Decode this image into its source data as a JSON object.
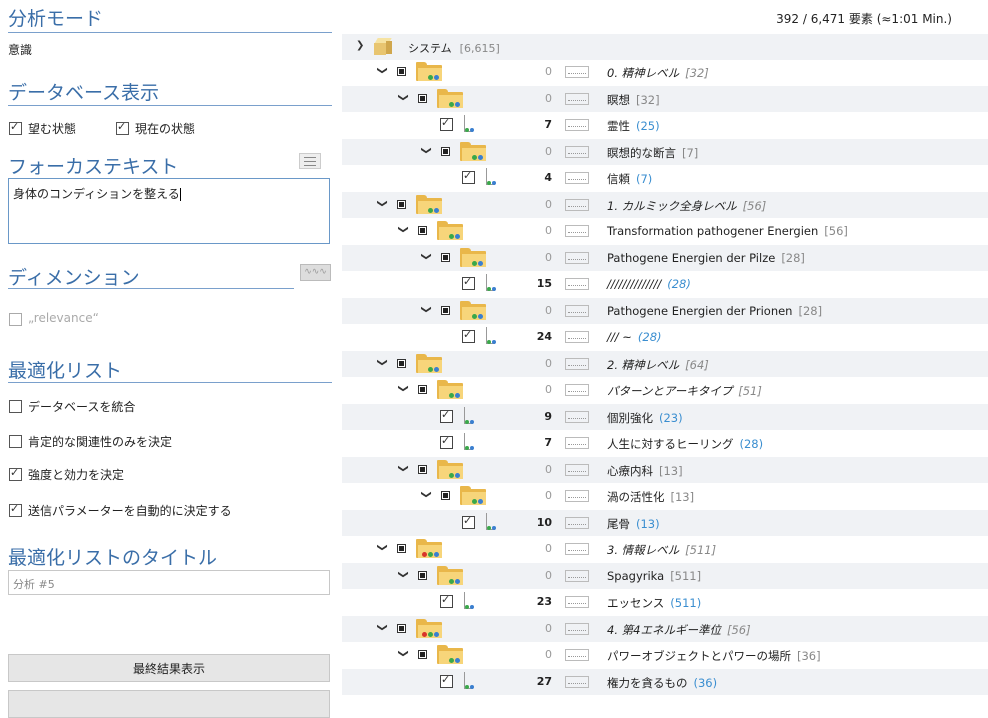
{
  "left": {
    "analysis_mode": {
      "title": "分析モード",
      "value": "意識"
    },
    "database_display": {
      "title": "データベース表示",
      "desired_label": "望む状態",
      "current_label": "現在の状態"
    },
    "focus_text": {
      "title": "フォーカステキスト",
      "value": "身体のコンディションを整える"
    },
    "dimension": {
      "title": "ディメンション",
      "relevance_label": "„relevance“"
    },
    "optimization_list": {
      "title": "最適化リスト",
      "options": [
        {
          "label": "データベースを統合",
          "checked": false
        },
        {
          "label": "肯定的な関連性のみを決定",
          "checked": false
        },
        {
          "label": "強度と効力を決定",
          "checked": true
        },
        {
          "label": "送信パラメーターを自動的に決定する",
          "checked": true
        }
      ]
    },
    "list_title": {
      "title": "最適化リストのタイトル",
      "placeholder": "分析 #5"
    },
    "buttons": {
      "show_final": "最終結果表示"
    }
  },
  "right": {
    "count": "392 / 6,471 要素 (≈1:01 Min.)",
    "root": {
      "label": "システム",
      "bracket": "[6,615]"
    },
    "rows": [
      {
        "level": 1,
        "kind": "folder",
        "num": "0",
        "label": "0. 精神レベル",
        "bracket": "[32]",
        "italic": true,
        "alt": false
      },
      {
        "level": 2,
        "kind": "folder",
        "num": "0",
        "label": "瞑想",
        "bracket": "[32]",
        "alt": true
      },
      {
        "level": 3,
        "kind": "leaf",
        "num": "7",
        "label": "霊性",
        "link": "(25)",
        "alt": false
      },
      {
        "level": 3,
        "kind": "folder",
        "num": "0",
        "label": "瞑想的な断言",
        "bracket": "[7]",
        "alt": true
      },
      {
        "level": 4,
        "kind": "leaf",
        "num": "4",
        "label": "信頼",
        "link": "(7)",
        "alt": false
      },
      {
        "level": 1,
        "kind": "folder",
        "num": "0",
        "label": "1. カルミック全身レベル",
        "bracket": "[56]",
        "italic": true,
        "alt": true
      },
      {
        "level": 2,
        "kind": "folder",
        "num": "0",
        "label": "Transformation pathogener Energien",
        "bracket": "[56]",
        "alt": false
      },
      {
        "level": 3,
        "kind": "folder",
        "num": "0",
        "label": "Pathogene Energien der Pilze",
        "bracket": "[28]",
        "alt": true
      },
      {
        "level": 4,
        "kind": "leaf",
        "num": "15",
        "label": "//////////////",
        "link": "(28)",
        "italic": true,
        "alt": false
      },
      {
        "level": 3,
        "kind": "folder",
        "num": "0",
        "label": "Pathogene Energien der Prionen",
        "bracket": "[28]",
        "alt": true
      },
      {
        "level": 4,
        "kind": "leaf",
        "num": "24",
        "label": "/// ~",
        "link": "(28)",
        "italic": true,
        "alt": false
      },
      {
        "level": 1,
        "kind": "folder",
        "num": "0",
        "label": "2. 精神レベル",
        "bracket": "[64]",
        "italic": true,
        "alt": true
      },
      {
        "level": 2,
        "kind": "folder",
        "num": "0",
        "label": "パターンとアーキタイプ",
        "bracket": "[51]",
        "italic": true,
        "alt": false
      },
      {
        "level": 3,
        "kind": "leaf",
        "num": "9",
        "label": "個別強化",
        "link": "(23)",
        "alt": true
      },
      {
        "level": 3,
        "kind": "leaf",
        "num": "7",
        "label": "人生に対するヒーリング",
        "link": "(28)",
        "alt": false
      },
      {
        "level": 2,
        "kind": "folder",
        "num": "0",
        "label": "心療内科",
        "bracket": "[13]",
        "alt": true
      },
      {
        "level": 3,
        "kind": "folder",
        "num": "0",
        "label": "渦の活性化",
        "bracket": "[13]",
        "alt": false
      },
      {
        "level": 4,
        "kind": "leaf",
        "num": "10",
        "label": "尾骨",
        "link": "(13)",
        "alt": true
      },
      {
        "level": 1,
        "kind": "folder",
        "num": "0",
        "label": "3. 情報レベル",
        "bracket": "[511]",
        "italic": true,
        "alt": false,
        "dots": "red"
      },
      {
        "level": 2,
        "kind": "folder",
        "num": "0",
        "label": "Spagyrika",
        "bracket": "[511]",
        "alt": true
      },
      {
        "level": 3,
        "kind": "leaf",
        "num": "23",
        "label": "エッセンス",
        "link": "(511)",
        "alt": false
      },
      {
        "level": 1,
        "kind": "folder",
        "num": "0",
        "label": "4. 第4エネルギー準位",
        "bracket": "[56]",
        "italic": true,
        "alt": true,
        "dots": "red"
      },
      {
        "level": 2,
        "kind": "folder",
        "num": "0",
        "label": "パワーオブジェクトとパワーの場所",
        "bracket": "[36]",
        "alt": false
      },
      {
        "level": 3,
        "kind": "leaf",
        "num": "27",
        "label": "権力を貪るもの",
        "link": "(36)",
        "alt": true
      }
    ]
  }
}
